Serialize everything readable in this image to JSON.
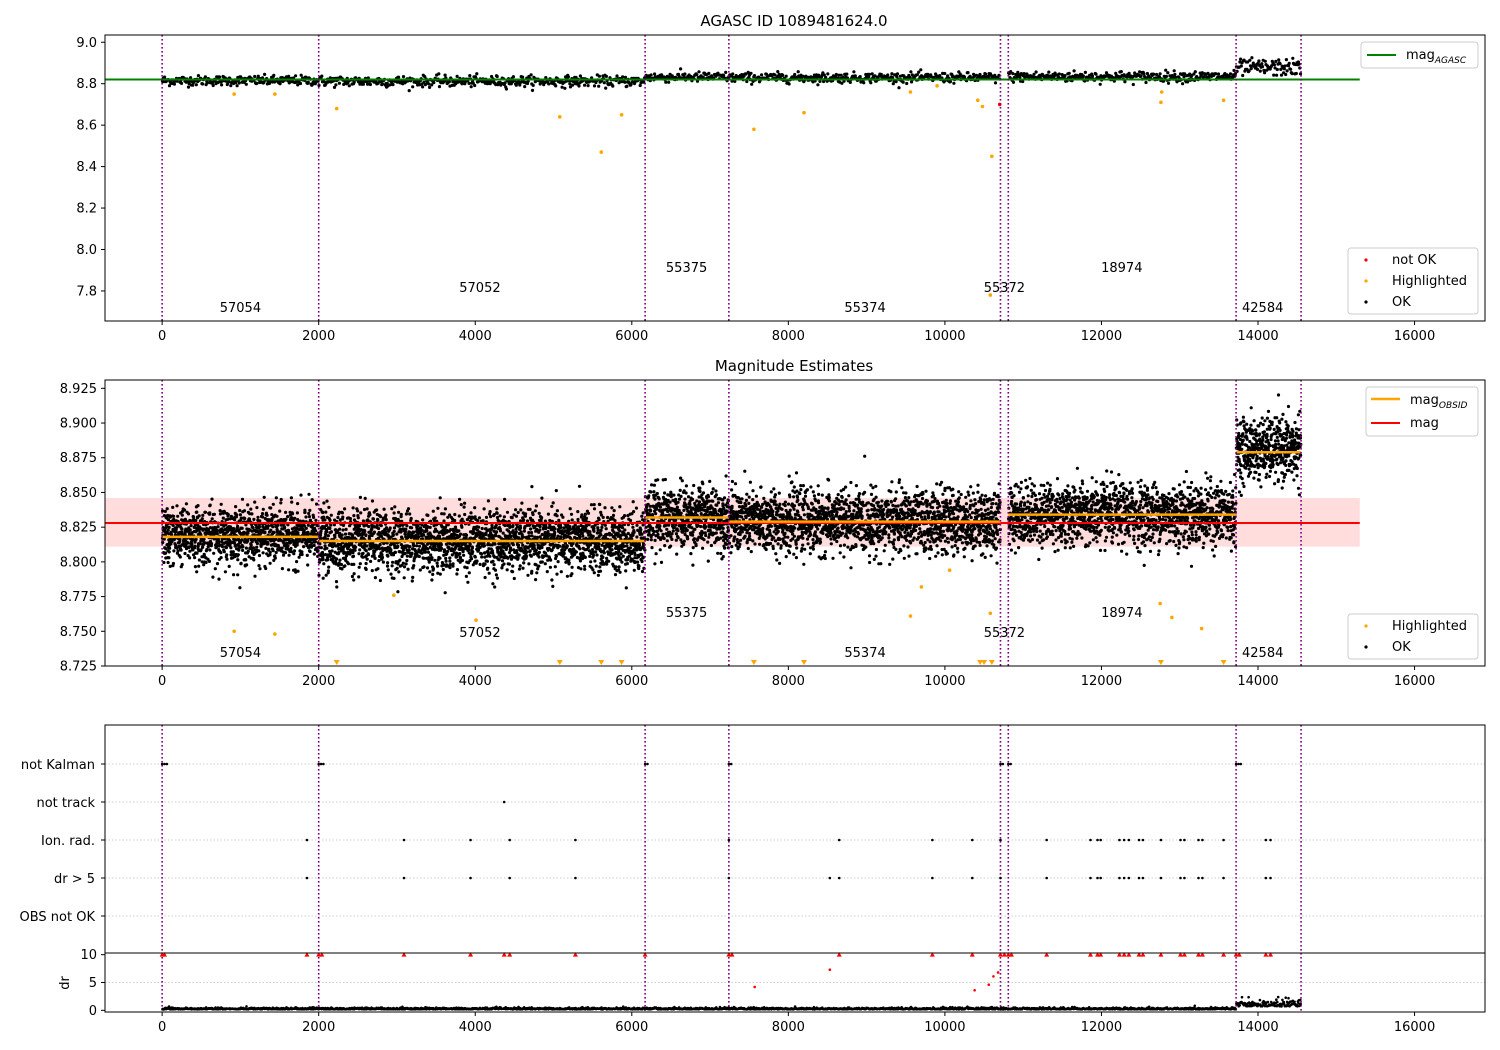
{
  "chart_data": [
    {
      "type": "scatter",
      "title": "AGASC ID 1089481624.0",
      "xlabel": "",
      "ylabel": "",
      "xlim": [
        -730,
        16900
      ],
      "ylim": [
        7.655,
        9.035
      ],
      "xticks": [
        0,
        2000,
        4000,
        6000,
        8000,
        10000,
        12000,
        14000,
        16000
      ],
      "xtick_labels": [
        "0",
        "2000",
        "4000",
        "6000",
        "8000",
        "10000",
        "12000",
        "14000",
        "16000"
      ],
      "yticks": [
        7.8,
        8.0,
        8.2,
        8.4,
        8.6,
        8.8,
        9.0
      ],
      "ytick_labels": [
        "7.8",
        "8.0",
        "8.2",
        "8.4",
        "8.6",
        "8.8",
        "9.0"
      ],
      "grid": false,
      "observation_boundaries": [
        0,
        2000,
        6170,
        7240,
        10710,
        10810,
        13720,
        14550
      ],
      "obsid_labels": [
        {
          "text": "57054",
          "x": 1000,
          "level": "low"
        },
        {
          "text": "57052",
          "x": 4060,
          "level": "mid"
        },
        {
          "text": "55375",
          "x": 6700,
          "level": "high"
        },
        {
          "text": "55374",
          "x": 8980,
          "level": "low"
        },
        {
          "text": "55372",
          "x": 10760,
          "level": "mid"
        },
        {
          "text": "18974",
          "x": 12260,
          "level": "high"
        },
        {
          "text": "42584",
          "x": 14060,
          "level": "low"
        }
      ],
      "mag_agasc": 8.82,
      "mag_line_xrange": [
        -730,
        15300
      ],
      "segments": [
        {
          "x0": 0,
          "x1": 2000,
          "mean": 8.815,
          "spread": 0.012
        },
        {
          "x0": 2000,
          "x1": 6170,
          "mean": 8.812,
          "spread": 0.013
        },
        {
          "x0": 6170,
          "x1": 7240,
          "mean": 8.832,
          "spread": 0.012
        },
        {
          "x0": 7240,
          "x1": 10710,
          "mean": 8.829,
          "spread": 0.012
        },
        {
          "x0": 10810,
          "x1": 13720,
          "mean": 8.834,
          "spread": 0.013
        },
        {
          "x0": 13720,
          "x1": 14550,
          "mean": 8.878,
          "spread": 0.02
        }
      ],
      "highlighted_points": [
        [
          920,
          8.75
        ],
        [
          1440,
          8.75
        ],
        [
          2230,
          8.68
        ],
        [
          5080,
          8.64
        ],
        [
          5610,
          8.47
        ],
        [
          5870,
          8.65
        ],
        [
          7560,
          8.58
        ],
        [
          8200,
          8.66
        ],
        [
          9560,
          8.76
        ],
        [
          9900,
          8.79
        ],
        [
          10420,
          8.72
        ],
        [
          10480,
          8.69
        ],
        [
          10600,
          8.45
        ],
        [
          10580,
          7.78
        ],
        [
          12760,
          8.71
        ],
        [
          12770,
          8.76
        ],
        [
          13560,
          8.72
        ]
      ],
      "not_ok_points": [
        [
          10700,
          8.7
        ]
      ],
      "legend": {
        "placement": "top-right",
        "entries": [
          "mag$_{AGASC}$"
        ],
        "label_main": "mag",
        "label_sub": "AGASC"
      },
      "legend2": {
        "placement": "bottom-right",
        "entries": [
          "not OK",
          "Highlighted",
          "OK"
        ]
      },
      "colors": {
        "ok": "#000000",
        "highlighted": "#ffa500",
        "not_ok": "#ff0000",
        "mag_agasc": "#008000",
        "boundary": "#800080"
      }
    },
    {
      "type": "scatter",
      "title": "Magnitude Estimates",
      "xlabel": "",
      "ylabel": "",
      "xlim": [
        -730,
        16900
      ],
      "ylim": [
        8.725,
        8.931
      ],
      "xticks": [
        0,
        2000,
        4000,
        6000,
        8000,
        10000,
        12000,
        14000,
        16000
      ],
      "xtick_labels": [
        "0",
        "2000",
        "4000",
        "6000",
        "8000",
        "10000",
        "12000",
        "14000",
        "16000"
      ],
      "yticks": [
        8.725,
        8.75,
        8.775,
        8.8,
        8.825,
        8.85,
        8.875,
        8.9,
        8.925
      ],
      "ytick_labels": [
        "8.725",
        "8.750",
        "8.775",
        "8.800",
        "8.825",
        "8.850",
        "8.875",
        "8.900",
        "8.925"
      ],
      "grid": false,
      "observation_boundaries": [
        0,
        2000,
        6170,
        7240,
        10710,
        10810,
        13720,
        14550
      ],
      "obsid_labels": [
        {
          "text": "57054",
          "x": 1000,
          "level": "low"
        },
        {
          "text": "57052",
          "x": 4060,
          "level": "mid"
        },
        {
          "text": "55375",
          "x": 6700,
          "level": "high"
        },
        {
          "text": "55374",
          "x": 8980,
          "level": "low"
        },
        {
          "text": "55372",
          "x": 10760,
          "level": "mid"
        },
        {
          "text": "18974",
          "x": 12260,
          "level": "high"
        },
        {
          "text": "42584",
          "x": 14060,
          "level": "low"
        }
      ],
      "mag": 8.828,
      "mag_band": [
        8.811,
        8.846
      ],
      "mag_line_xrange": [
        -730,
        15300
      ],
      "mag_obsid": [
        {
          "x0": 0,
          "x1": 2000,
          "value": 8.818
        },
        {
          "x0": 2000,
          "x1": 6170,
          "value": 8.815
        },
        {
          "x0": 6170,
          "x1": 7240,
          "value": 8.832
        },
        {
          "x0": 7240,
          "x1": 10710,
          "value": 8.829
        },
        {
          "x0": 10810,
          "x1": 13720,
          "value": 8.834
        },
        {
          "x0": 13720,
          "x1": 14550,
          "value": 8.879
        }
      ],
      "segments": [
        {
          "x0": 0,
          "x1": 2000,
          "mean": 8.819,
          "spread": 0.01
        },
        {
          "x0": 2000,
          "x1": 6170,
          "mean": 8.815,
          "spread": 0.011
        },
        {
          "x0": 6170,
          "x1": 7240,
          "mean": 8.832,
          "spread": 0.011
        },
        {
          "x0": 7240,
          "x1": 10710,
          "mean": 8.829,
          "spread": 0.011
        },
        {
          "x0": 10810,
          "x1": 13720,
          "mean": 8.834,
          "spread": 0.011
        },
        {
          "x0": 13720,
          "x1": 14550,
          "mean": 8.881,
          "spread": 0.011
        }
      ],
      "highlighted_points": [
        [
          920,
          8.75
        ],
        [
          1440,
          8.748
        ],
        [
          2960,
          8.776
        ],
        [
          4010,
          8.758
        ],
        [
          9560,
          8.761
        ],
        [
          9700,
          8.782
        ],
        [
          10060,
          8.794
        ],
        [
          10580,
          8.763
        ],
        [
          12750,
          8.77
        ],
        [
          12900,
          8.76
        ],
        [
          13280,
          8.752
        ]
      ],
      "clipped_markers_x": [
        2230,
        5080,
        5610,
        5870,
        7560,
        8200,
        10450,
        10500,
        10600,
        12760,
        13560
      ],
      "legend": {
        "placement": "top-right",
        "entries": [
          "mag$_{OBSID}$",
          "mag"
        ],
        "label_main": "mag",
        "label_sub": "OBSID",
        "label_mag": "mag"
      },
      "legend2": {
        "placement": "bottom-right",
        "entries": [
          "Highlighted",
          "OK"
        ]
      },
      "colors": {
        "ok": "#000000",
        "highlighted": "#ffa500",
        "mag": "#ff0000",
        "mag_band": "#ffdddd",
        "mag_obsid": "#ffa500",
        "boundary": "#800080"
      }
    },
    {
      "type": "scatter",
      "title": "",
      "xlabel": "",
      "ylabel": "",
      "xlim": [
        -730,
        16900
      ],
      "flag_rows": [
        "not Kalman",
        "not track",
        "Ion. rad.",
        "dr > 5",
        "OBS not OK"
      ],
      "observation_boundaries": [
        0,
        2000,
        6170,
        7240,
        10710,
        10810,
        13720,
        14550
      ],
      "not_kalman_x": [
        0,
        30,
        60,
        2000,
        2030,
        2060,
        6170,
        6200,
        7240,
        7270,
        10710,
        10740,
        10810,
        10840,
        13720,
        13750,
        13780
      ],
      "not_track_x": [
        4370
      ],
      "ion_rad_x": [
        1850,
        3090,
        3940,
        4440,
        5280,
        7240,
        8650,
        9840,
        10350,
        10710,
        11300,
        11860,
        11950,
        11990,
        12230,
        12290,
        12350,
        12480,
        12530,
        12760,
        13010,
        13060,
        13240,
        13290,
        13560,
        14100,
        14160
      ],
      "dr_gt5_x": [
        1850,
        3090,
        3940,
        4440,
        5280,
        7240,
        8530,
        8650,
        9840,
        10350,
        10710,
        11300,
        11860,
        11950,
        11990,
        12230,
        12290,
        12350,
        12480,
        12530,
        12760,
        13010,
        13060,
        13240,
        13290,
        13560,
        14100,
        14160
      ],
      "grid": true,
      "colors": {
        "flag": "#000000",
        "boundary": "#800080",
        "grid": "#c0c0c0"
      }
    },
    {
      "type": "scatter",
      "title": "",
      "xlabel": "",
      "ylabel": "dr",
      "xlim": [
        -730,
        16900
      ],
      "ylim": [
        -0.3,
        10.3
      ],
      "yticks": [
        0,
        5,
        10
      ],
      "ytick_labels": [
        "0",
        "5",
        "10"
      ],
      "xticks": [
        0,
        2000,
        4000,
        6000,
        8000,
        10000,
        12000,
        14000,
        16000
      ],
      "xtick_labels": [
        "0",
        "2000",
        "4000",
        "6000",
        "8000",
        "10000",
        "12000",
        "14000",
        "16000"
      ],
      "grid": true,
      "observation_boundaries": [
        0,
        2000,
        6170,
        7240,
        10710,
        10810,
        13720,
        14550
      ],
      "capped_markers_x": [
        0,
        30,
        1850,
        2000,
        2040,
        3090,
        3940,
        4370,
        4440,
        5280,
        6170,
        7240,
        7280,
        8650,
        9840,
        10350,
        10710,
        10760,
        10810,
        10850,
        11300,
        11860,
        11950,
        11990,
        12230,
        12290,
        12350,
        12480,
        12530,
        12760,
        13010,
        13060,
        13240,
        13290,
        13560,
        13720,
        13760,
        14100,
        14160
      ],
      "red_points": [
        [
          7570,
          4.2
        ],
        [
          8530,
          7.3
        ],
        [
          10380,
          3.6
        ],
        [
          10560,
          4.6
        ],
        [
          10620,
          6.1
        ],
        [
          10680,
          6.8
        ]
      ],
      "baseline_segments": [
        {
          "x0": 0,
          "x1": 13720,
          "mean": 0.25,
          "spread": 0.15
        },
        {
          "x0": 13720,
          "x1": 14550,
          "mean": 1.0,
          "spread": 0.6
        }
      ],
      "colors": {
        "ok": "#000000",
        "flagged": "#ff0000",
        "boundary": "#800080",
        "grid": "#c0c0c0"
      }
    }
  ]
}
